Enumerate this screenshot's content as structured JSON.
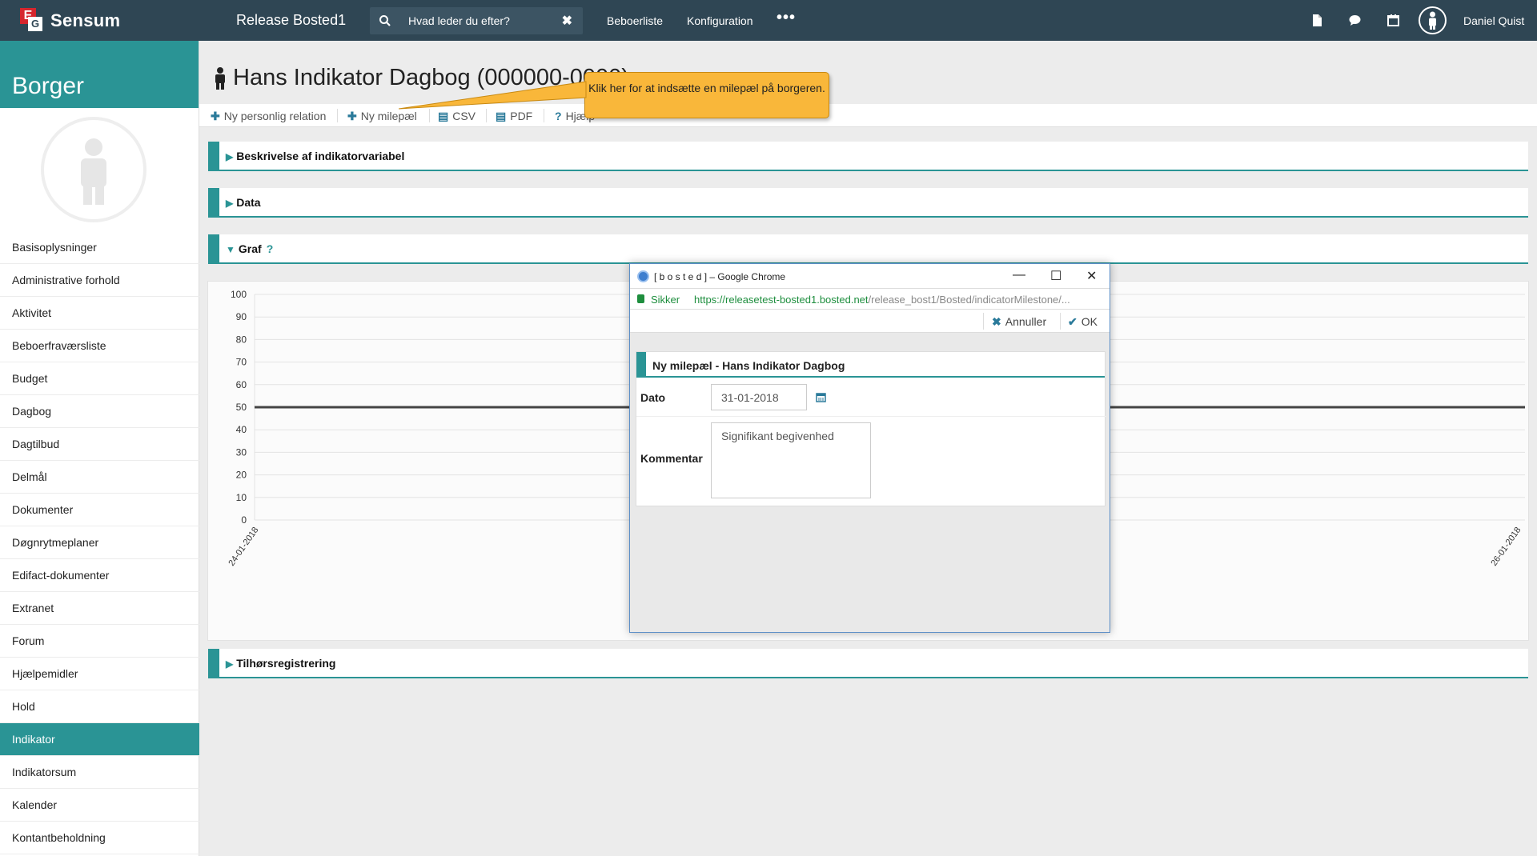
{
  "topbar": {
    "logo_e": "E",
    "logo_g": "G",
    "brand": "Sensum",
    "environment": "Release Bosted1",
    "search_placeholder": "Hvad leder du efter?",
    "nav": [
      "Beboerliste",
      "Konfiguration"
    ],
    "more": "•••",
    "user": "Daniel Quist"
  },
  "sidebar": {
    "title": "Borger",
    "items": [
      "Basisoplysninger",
      "Administrative forhold",
      "Aktivitet",
      "Beboerfraværsliste",
      "Budget",
      "Dagbog",
      "Dagtilbud",
      "Delmål",
      "Dokumenter",
      "Døgnrytmeplaner",
      "Edifact-dokumenter",
      "Extranet",
      "Forum",
      "Hjælpemidler",
      "Hold",
      "Indikator",
      "Indikatorsum",
      "Kalender",
      "Kontantbeholdning"
    ],
    "active_item": "Indikator"
  },
  "page": {
    "title": "Hans Indikator Dagbog (000000-0000)",
    "toolbar": [
      "Ny personlig relation",
      "Ny milepæl",
      "CSV",
      "PDF",
      "Hjælp"
    ],
    "tooltip": "Klik her for at indsætte en milepæl på borgeren.",
    "sections": {
      "beskrivelse": "Beskrivelse af indikatorvariabel",
      "data": "Data",
      "graf": "Graf",
      "graf_help": "?",
      "tilhors": "Tilhørsregistrering"
    }
  },
  "chart_data": {
    "type": "line",
    "x": [
      "24-01-2018",
      "26-01-2018"
    ],
    "series": [
      {
        "values": [
          50,
          50
        ]
      }
    ],
    "y_ticks": [
      0,
      10,
      20,
      30,
      40,
      50,
      60,
      70,
      80,
      90,
      100
    ],
    "ylim": [
      0,
      100
    ],
    "x_tick_labels": [
      "24-01-2018",
      "26-01-2018"
    ],
    "grid": true,
    "line_color": "#444444"
  },
  "popup": {
    "window_title": "[ b o s t e d ] – Google Chrome",
    "secure_label": "Sikker",
    "url_host": "https://releasetest-bosted1.bosted.net",
    "url_path": "/release_bost1/Bosted/indicatorMilestone/...",
    "cancel_label": "Annuller",
    "ok_label": "OK",
    "form_title": "Ny milepæl - Hans Indikator Dagbog",
    "date_label": "Dato",
    "date_value": "31-01-2018",
    "comment_label": "Kommentar",
    "comment_value": "Signifikant begivenhed"
  },
  "colors": {
    "topbar": "#2f4654",
    "accent": "#2a9495",
    "tooltip": "#f9b73a"
  }
}
